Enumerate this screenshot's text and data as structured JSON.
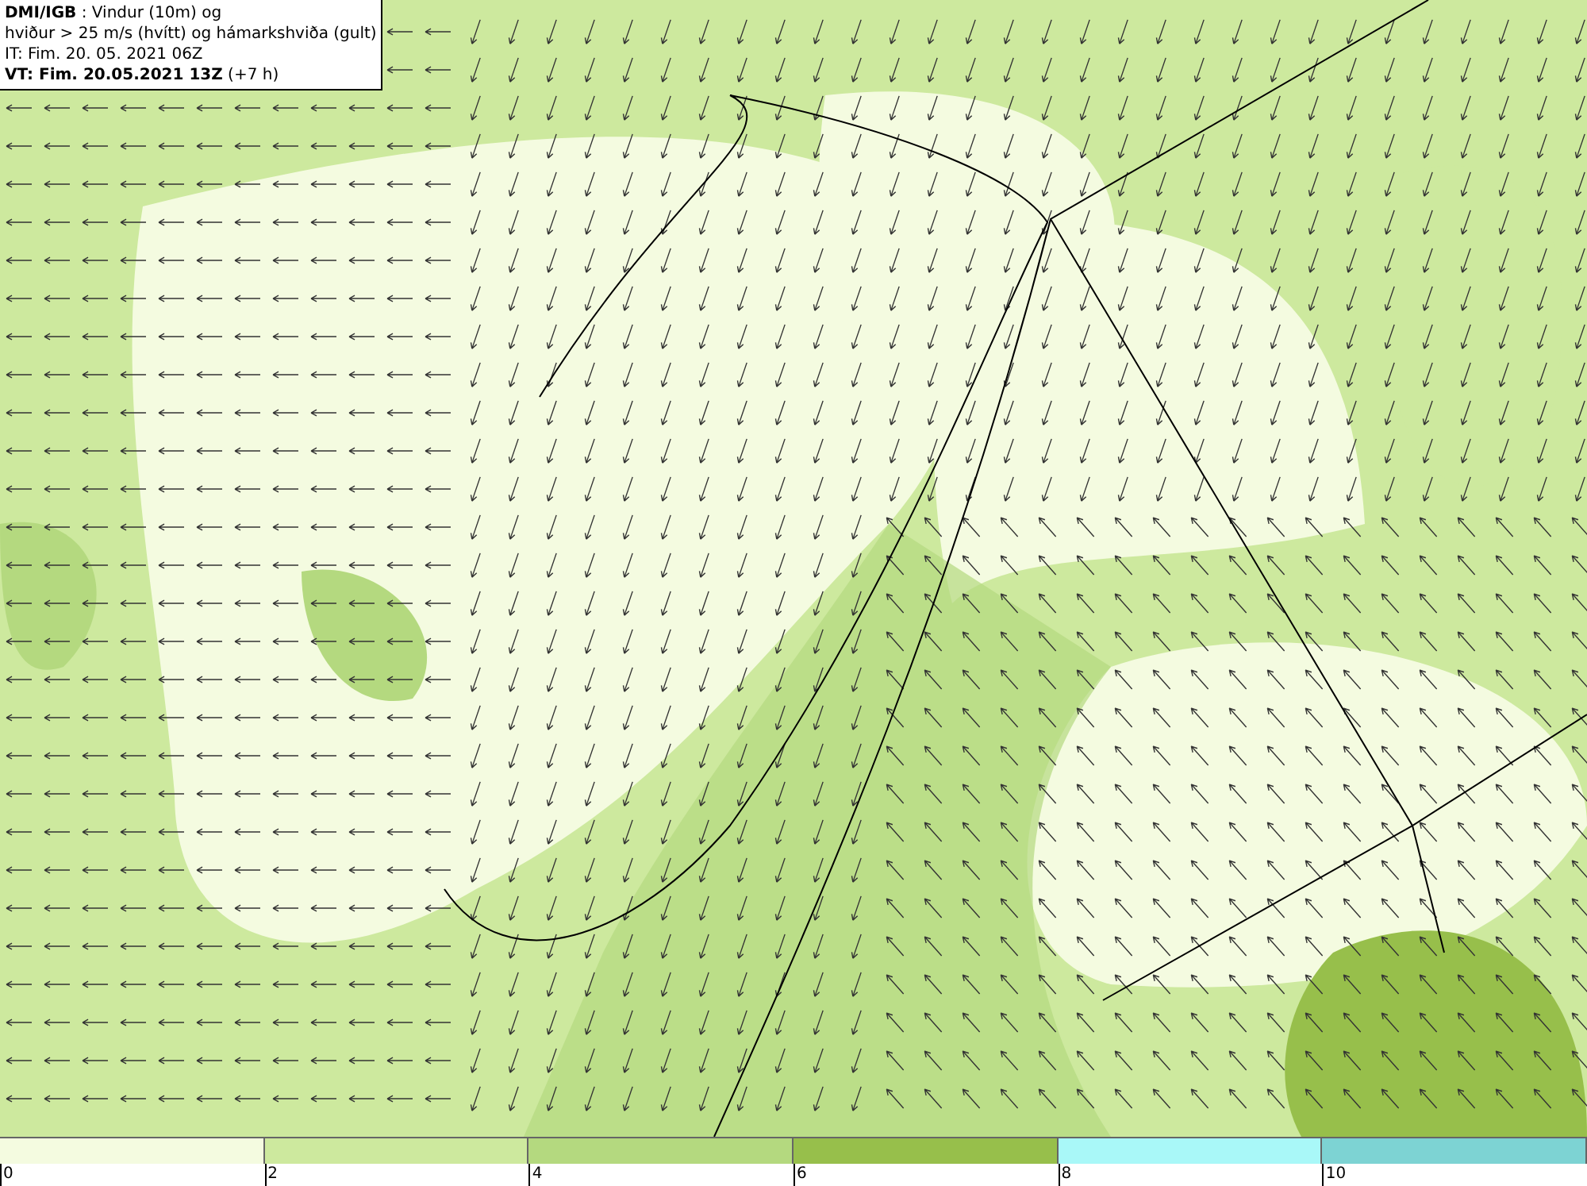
{
  "info_box": {
    "lines": [
      "**DMI/IGB** : Vindur (10m) og",
      "hviður > 25 m/s (hvítt) og hámarkshviða (gult)",
      "IT: Fim. 20. 05. 2021 06Z",
      "**VT: Fim. 20.05.2021 13Z** (+7 h)"
    ]
  },
  "legend": {
    "segments": [
      {
        "color": "#f4fbe0",
        "label": "0"
      },
      {
        "color": "#cde99e",
        "label": "2"
      },
      {
        "color": "#b4d97f",
        "label": "4"
      },
      {
        "color": "#97bf4b",
        "label": "6"
      },
      {
        "color": "#a9f8f8",
        "label": "8"
      },
      {
        "color": "#7dd3d3",
        "label": "10"
      }
    ]
  }
}
